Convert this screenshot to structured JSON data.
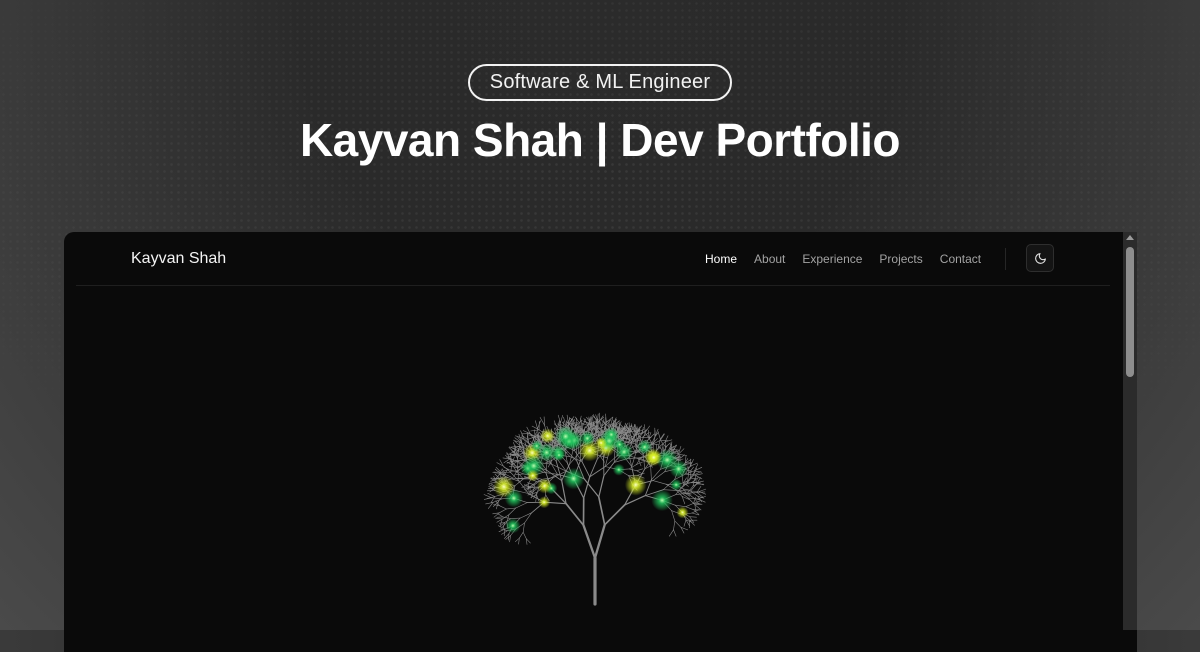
{
  "hero": {
    "badge": "Software & ML Engineer",
    "title": "Kayvan Shah | Dev Portfolio"
  },
  "navbar": {
    "brand": "Kayvan Shah",
    "links": [
      {
        "label": "Home",
        "active": true
      },
      {
        "label": "About",
        "active": false
      },
      {
        "label": "Experience",
        "active": false
      },
      {
        "label": "Projects",
        "active": false
      },
      {
        "label": "Contact",
        "active": false
      }
    ],
    "theme_toggle_icon": "moon-icon"
  },
  "colors": {
    "window_bg": "#0a0a0a",
    "branch": "#8a8a8a",
    "glow_green": "#22c55e",
    "glow_yellow": "#d9f024"
  }
}
